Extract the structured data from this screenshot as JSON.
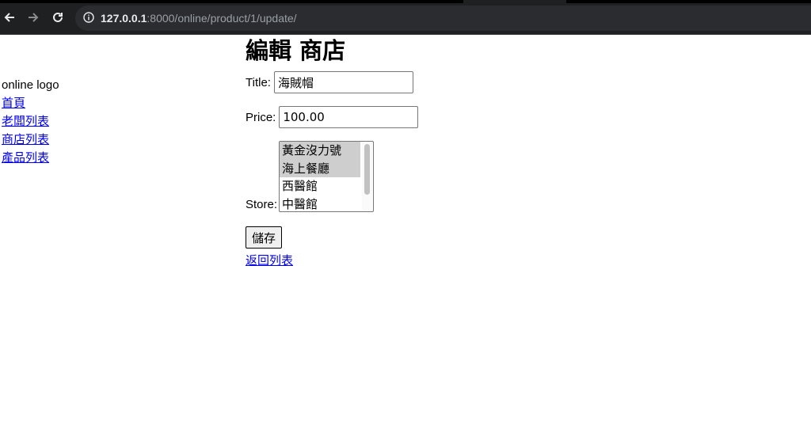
{
  "browser": {
    "back_icon": "arrow-left-icon",
    "forward_icon": "arrow-right-icon",
    "reload_icon": "reload-icon",
    "url_host": "127.0.0.1",
    "url_rest": ":8000/online/product/1/update/"
  },
  "sidebar": {
    "logo": "online logo",
    "links": [
      "首頁",
      "老闆列表",
      "商店列表",
      "產品列表"
    ]
  },
  "main": {
    "title": "編輯 商店",
    "fields": {
      "title_label": "Title:",
      "title_value": "海賊帽",
      "price_label": "Price:",
      "price_value": "100.00",
      "store_label": "Store:",
      "store_options": [
        {
          "label": "黃金沒力號",
          "selected": true
        },
        {
          "label": "海上餐廳",
          "selected": true
        },
        {
          "label": "西醫館",
          "selected": false
        },
        {
          "label": "中醫館",
          "selected": false
        }
      ]
    },
    "save_label": "儲存",
    "back_label": "返回列表"
  }
}
